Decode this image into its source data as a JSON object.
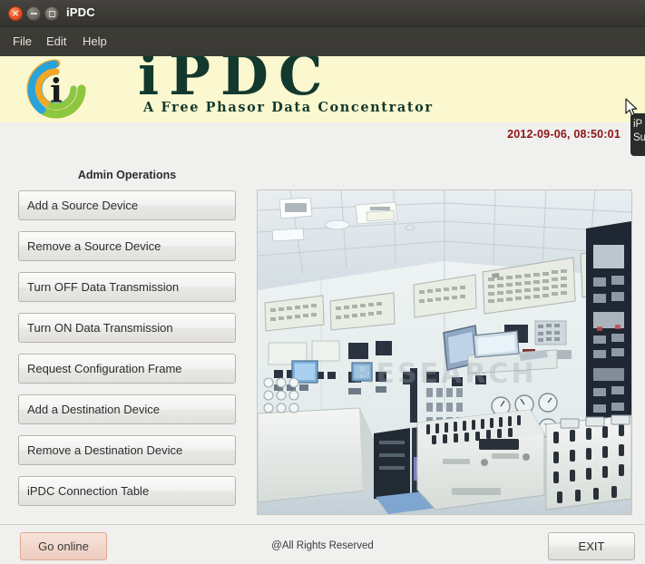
{
  "window": {
    "title": "iPDC",
    "controls": [
      {
        "name": "close",
        "glyph": "×"
      },
      {
        "name": "minimize",
        "glyph": ""
      },
      {
        "name": "maximize",
        "glyph": ""
      }
    ]
  },
  "menubar": {
    "items": [
      {
        "label": "File"
      },
      {
        "label": "Edit"
      },
      {
        "label": "Help"
      }
    ]
  },
  "banner": {
    "brand": "iPDC",
    "tagline": "A Free Phasor Data Concentrator",
    "logo_icon": "ipdc-swirl-logo-icon",
    "background": "#fbf8cf",
    "brand_color": "#13392e",
    "logo_colors": {
      "blue": "#29a3dc",
      "green": "#8dc63f",
      "orange": "#f5a623",
      "ink": "#1c1c1c"
    }
  },
  "status": {
    "timestamp": "2012-09-06, 08:50:01",
    "timestamp_color": "#8e1414"
  },
  "tooltip": {
    "line1": "iP",
    "line2": "Su"
  },
  "main": {
    "section_title": "Admin Operations",
    "operations": [
      {
        "label": "Add a Source Device",
        "name": "add-source-device"
      },
      {
        "label": "Remove a Source Device",
        "name": "remove-source-device"
      },
      {
        "label": "Turn OFF Data Transmission",
        "name": "turn-off-data-transmission"
      },
      {
        "label": "Turn ON Data Transmission",
        "name": "turn-on-data-transmission"
      },
      {
        "label": "Request Configuration Frame",
        "name": "request-configuration-frame"
      },
      {
        "label": "Add a Destination Device",
        "name": "add-destination-device"
      },
      {
        "label": "Remove a Destination Device",
        "name": "remove-destination-device"
      },
      {
        "label": "iPDC Connection Table",
        "name": "ipdc-connection-table"
      }
    ],
    "photo": {
      "name": "control-room-photo",
      "description": "Power plant control room with wall panels and consoles"
    }
  },
  "footer": {
    "go_online_label": "Go online",
    "copyright": "@All Rights Reserved",
    "exit_label": "EXIT",
    "go_online_color": "#f2d7cc"
  }
}
